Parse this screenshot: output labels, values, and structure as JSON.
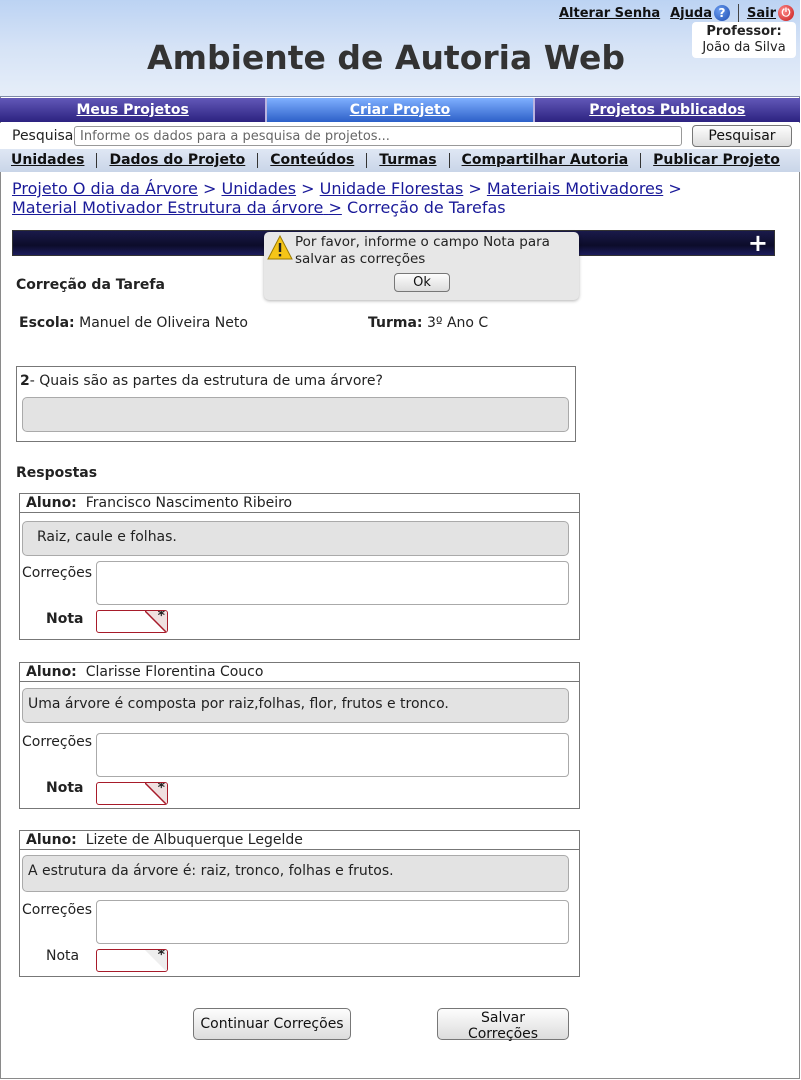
{
  "header": {
    "app_title": "Ambiente de Autoria Web",
    "links": {
      "change_password": "Alterar Senha",
      "help": "Ajuda",
      "logout": "Sair"
    },
    "professor_label": "Professor:",
    "professor_name": "João da Silva"
  },
  "main_nav": [
    "Meus Projetos",
    "Criar Projeto",
    "Projetos Publicados"
  ],
  "search": {
    "label": "Pesquisa",
    "placeholder": "Informe os dados para a pesquisa de projetos...",
    "button": "Pesquisar"
  },
  "sub_nav": [
    "Unidades",
    "Dados do Projeto",
    "Conteúdos",
    "Turmas",
    "Compartilhar Autoria",
    "Publicar Projeto"
  ],
  "breadcrumb": [
    "Projeto O dia da Árvore",
    "Unidades",
    "Unidade Florestas",
    "Materiais Motivadores",
    "Material Motivador Estrutura da árvore",
    "Correção de Tarefas"
  ],
  "breadcrumb_sep": ">",
  "alert": {
    "message": "Por favor, informe o campo Nota para salvar as correções",
    "ok": "Ok"
  },
  "page": {
    "title": "Correção da Tarefa",
    "school_label": "Escola:",
    "school": "Manuel de Oliveira Neto",
    "class_label": "Turma:",
    "class": "3º Ano C"
  },
  "question": {
    "number": "2",
    "text": "- Quais são as partes  da estrutura de uma árvore?"
  },
  "responses_title": "Respostas",
  "labels": {
    "student": "Aluno:",
    "corrections": "Correções",
    "grade": "Nota",
    "required_mark": "*"
  },
  "responses": [
    {
      "student": "Francisco Nascimento Ribeiro",
      "answer": "Raiz, caule e folhas."
    },
    {
      "student": "Clarisse  Florentina Couco",
      "answer": "Uma árvore é composta por raiz,folhas, flor, frutos e tronco."
    },
    {
      "student": "Lizete de Albuquerque Legelde",
      "answer": "A estrutura da árvore é: raiz, tronco, folhas e frutos."
    }
  ],
  "actions": {
    "continue": "Continuar Correções",
    "save": "Salvar Correções"
  },
  "colors": {
    "nav_dark": "#3a2e8c",
    "nav_active": "#2d60c8",
    "header_bg": "#d6e3f6",
    "link": "#1a1a99",
    "required_border": "#a71b2a"
  },
  "icons": [
    "help-icon",
    "power-icon",
    "plus-icon",
    "warning-icon"
  ]
}
